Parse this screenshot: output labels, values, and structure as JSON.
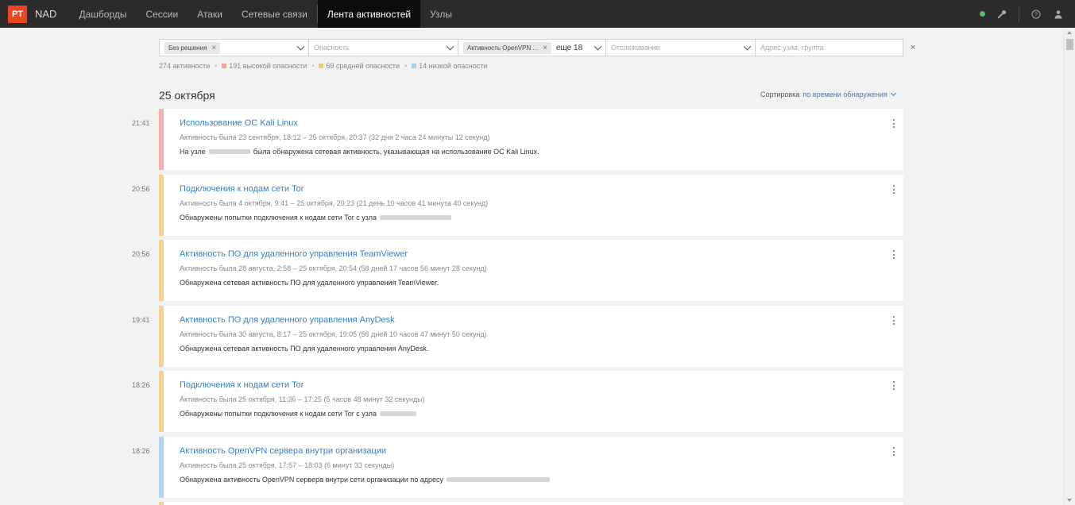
{
  "topbar": {
    "logo": "PT",
    "product": "NAD",
    "nav": [
      {
        "label": "Дашборды",
        "active": false
      },
      {
        "label": "Сессии",
        "active": false
      },
      {
        "label": "Атаки",
        "active": false
      },
      {
        "label": "Сетевые связи",
        "active": false
      },
      {
        "label": "Лента активностей",
        "active": true
      },
      {
        "label": "Узлы",
        "active": false
      }
    ],
    "status_color": "#5cb85c",
    "icons": [
      "wrench-icon",
      "help-icon",
      "user-icon"
    ]
  },
  "filters": {
    "resolution_chip": "Без решения",
    "severity_placeholder": "Опасность",
    "activity_chip": "Активность OpenVPN ...",
    "activity_more": "еще 18",
    "tracking_placeholder": "Отслеживание",
    "address_placeholder": "Адрес узла, группа"
  },
  "stats": {
    "total": "274 активности",
    "high": "191 высокой опасности",
    "medium": "69 средней опасности",
    "low": "14 низкой опасности",
    "colors": {
      "high": "#f2a4a0",
      "medium": "#f2c97e",
      "low": "#a9cdea"
    }
  },
  "date_header": "25 октября",
  "sort": {
    "label": "Сортировка",
    "value": "по времени обнаружения"
  },
  "activities": [
    {
      "time": "21:41",
      "severity_color": "#f2b3b0",
      "title": "Использование ОС Kali Linux",
      "meta": "Активность была 23 сентября, 18:12 – 25 октября, 20:37 (32 дня 2 часа 24 минуты 12 секунд)",
      "desc_before": "На узле",
      "desc_after": "была обнаружена сетевая активность, указывающая на использование ОС Kali Linux."
    },
    {
      "time": "20:56",
      "severity_color": "#f5d28f",
      "title": "Подключения к нодам сети Tor",
      "meta": "Активность была 4 октября, 9:41 – 25 октября, 20:23 (21 день 10 часов 41 минута 40 секунд)",
      "desc_before": "Обнаружены попытки подключения к нодам сети Tor с узла",
      "desc_after": ""
    },
    {
      "time": "20:56",
      "severity_color": "#f5d28f",
      "title": "Активность ПО для удаленного управления TeamViewer",
      "meta": "Активность была 28 августа, 2:58 – 25 октября, 20:54 (58 дней 17 часов 56 минут 28 секунд)",
      "desc_before": "Обнаружена сетевая активность ПО для удаленного управления TeamViewer.",
      "desc_after": ""
    },
    {
      "time": "19:41",
      "severity_color": "#f5d28f",
      "title": "Активность ПО для удаленного управления AnyDesk",
      "meta": "Активность была 30 августа, 8:17 – 25 октября, 19:05 (56 дней 10 часов 47 минут 50 секунд)",
      "desc_before": "Обнаружена сетевая активность ПО для удаленного управления AnyDesk.",
      "desc_after": ""
    },
    {
      "time": "18:26",
      "severity_color": "#f5d28f",
      "title": "Подключения к нодам сети Tor",
      "meta": "Активность была 25 октября, 11:36 – 17:25 (5 часов 48 минут 32 секунды)",
      "desc_before": "Обнаружены попытки подключения к нодам сети Tor с узла",
      "desc_after": ""
    },
    {
      "time": "18:26",
      "severity_color": "#b5d6ee",
      "title": "Активность OpenVPN сервера внутри организации",
      "meta": "Активность была 25 октября, 17:57 – 18:03 (6 минут 33 секунды)",
      "desc_before": "Обнаружена активность OpenVPN сервера внутри сети организации по адресу",
      "desc_after": ""
    }
  ]
}
